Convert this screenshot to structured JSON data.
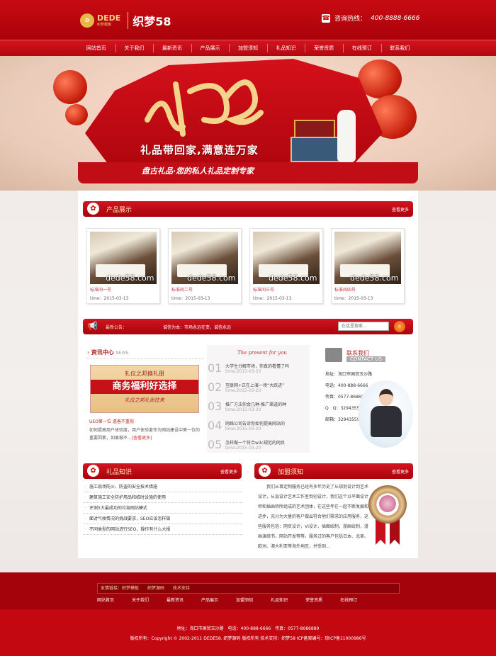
{
  "header": {
    "logo_badge": "D",
    "logo_name": "DEDE",
    "logo_sub": "织梦模板",
    "logo_cn": "织梦58",
    "hotline_label": "咨询热线：",
    "hotline_number": "400-8888-6666"
  },
  "nav": [
    "网站首页",
    "关于我们",
    "最新资讯",
    "产品展示",
    "加盟须知",
    "礼品知识",
    "荣誉资质",
    "在线预订",
    "联系我们"
  ],
  "banner": {
    "big_char": "礼",
    "line1": "礼品带回家,满意连万家",
    "line2": "盘古礼品·您的私人礼品定制专家"
  },
  "products": {
    "title": "产品展示",
    "more": "查看更多",
    "watermark": "dede58.com",
    "items": [
      {
        "name": "标准间一号",
        "date": "time：2015-03-13"
      },
      {
        "name": "标准间二号",
        "date": "time：2015-03-13"
      },
      {
        "name": "标准间三号",
        "date": "time：2015-03-13"
      },
      {
        "name": "标准间四号",
        "date": "time：2015-03-13"
      }
    ]
  },
  "announce": {
    "label": "最新公告：",
    "text": "诚信为本：市场永远在变，诚信永远",
    "search_placeholder": "在这里搜索..."
  },
  "news": {
    "title": "资讯中心",
    "title_en": "NEWS",
    "img_l1": "礼仪之邦换礼册",
    "img_l2": "商务福利好选择",
    "img_l3": "礼仪之邦礼尚往来",
    "headline": "UEO第一位 遗善不重视",
    "desc": "如何提高用户体验度，用户体验度作为网站建设中第一位的重要因素，如果做不...",
    "more": "[查看更多]"
  },
  "present": {
    "heading": "The present for you",
    "items": [
      {
        "n": "01",
        "t": "大学生分解市场，你真的看懂了吗",
        "d": "time:2015-03-20"
      },
      {
        "n": "02",
        "t": "互联网+正在上演一场“大跃进”",
        "d": "time:2015-03-20"
      },
      {
        "n": "03",
        "t": "推广方法你会几种-推广渠道的种",
        "d": "time:2015-03-20"
      },
      {
        "n": "04",
        "t": "网络公司告诉你如何提高网站的",
        "d": "time:2015-03-20"
      },
      {
        "n": "05",
        "t": "怎样做一个符合w3c规范的网页",
        "d": "time:2015-03-20"
      }
    ]
  },
  "contact": {
    "title": "联系我们",
    "title_en": "CONTACT US",
    "address": "地址：海口市国贸玉沙路",
    "phone": "电话：400-888-6666",
    "fax": "传真：0577-8686889",
    "qq": "Q　Q：329435595",
    "email": "邮箱：329435595@qq.com"
  },
  "knowledge": {
    "title": "礼品知识",
    "more": "查看更多",
    "items": [
      "施工现场防火、防盗的安全技术措施",
      "建筑施工安全防护用品和临时设施的使用",
      "评测5大最成功的垃圾网站模式",
      "面对气候情况的挑战要求，SEO应该怎样做",
      "不同类型的网站进行SEO，操作有什么大报"
    ]
  },
  "join": {
    "title": "加盟须知",
    "more": "查看更多",
    "text": "我们从事定制服务已经有多年历史了从规划设计到艺术设计，从加设计艺术工作室到创设计，我们这个以平面设计师和插画师所组成的艺术团体，在这些年在一起不断发展和进步，充分为大量的客户做出符合他们需求的应用服务，这些服务包括：网页设计，VI设计，插图绘制，漫画绘制，漫画演绎书，网站开发等等，服务过的客户包括日本、北美、欧洲、澳大利亚等海外地区，并受到..."
  },
  "footer": {
    "links_label": "友情链接：织梦模板",
    "link2": "织梦源码",
    "link3": "技术支持",
    "nav": [
      "网站首页",
      "关于我们",
      "最新资讯",
      "产品展示",
      "加盟须知",
      "礼品知识",
      "荣誉资质",
      "在线预订"
    ],
    "line1": "地址：海口市国贸玉沙路　电话：400-888-6666　传真：0577-8686889",
    "line2": "版权所有：Copyright © 2002-2011 DEDE58. 织梦源码 版权所有 技术支持：织梦58 ICP备案编号：琼ICP备11000986号"
  },
  "colors": {
    "brand_red": "#c40812",
    "gold": "#f4d080"
  }
}
